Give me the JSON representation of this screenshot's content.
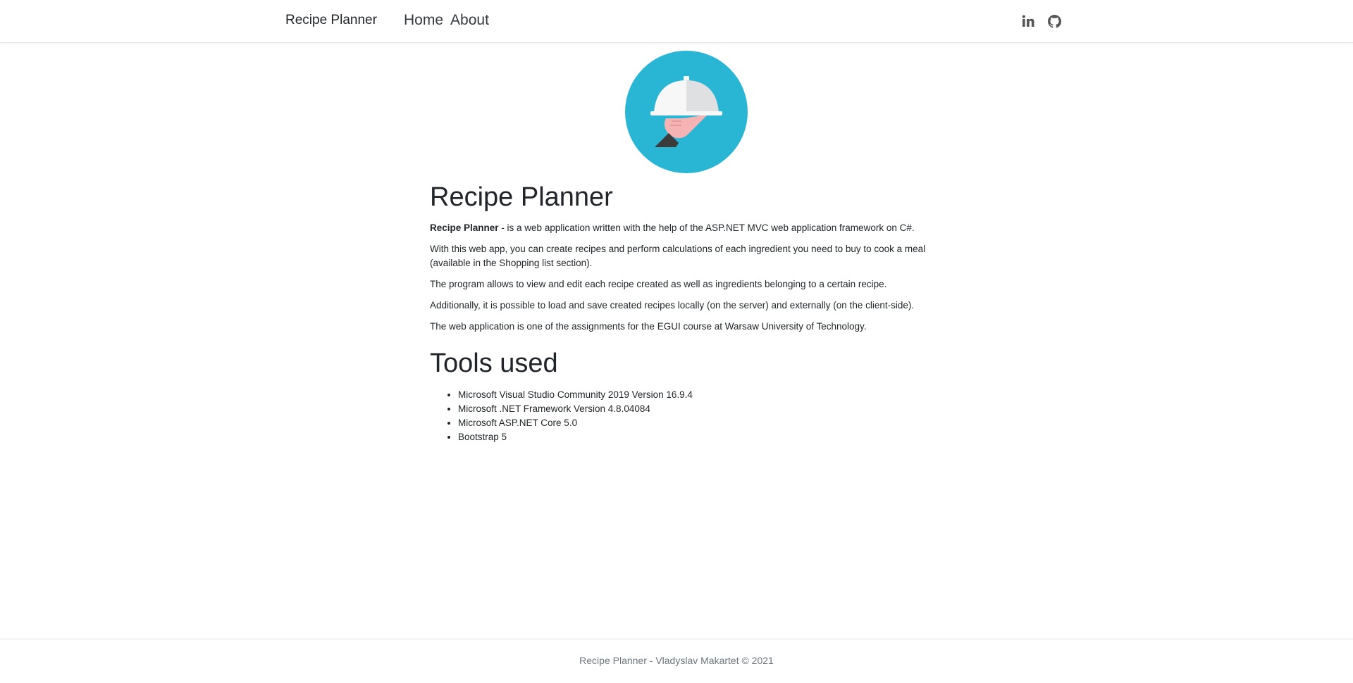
{
  "header": {
    "brand": "Recipe Planner",
    "nav": [
      "Home",
      "About"
    ],
    "social_icons": [
      "linkedin-icon",
      "github-icon"
    ]
  },
  "logo": {
    "icon": "cloche-serving-hand-icon",
    "colors": {
      "circle": "#29b6d5",
      "cloche_light": "#f7f7f7",
      "cloche_dark": "#dfe0e2",
      "hand": "#f5b3b3",
      "cuff": "#3b3b3b"
    }
  },
  "main": {
    "title": "Recipe Planner",
    "intro_bold": "Recipe Planner",
    "intro_rest": " - is a web application written with the help of the ASP.NET MVC web application framework on C#.",
    "paragraphs": [
      "With this web app, you can create recipes and perform calculations of each ingredient you need to buy to cook a meal (available in the Shopping list section).",
      "The program allows to view and edit each recipe created as well as ingredients belonging to a certain recipe.",
      "Additionally, it is possible to load and save created recipes locally (on the server) and externally (on the client-side).",
      "The web application is one of the assignments for the EGUI course at Warsaw University of Technology."
    ],
    "tools_title": "Tools used",
    "tools": [
      "Microsoft Visual Studio Community 2019 Version 16.9.4",
      "Microsoft .NET Framework Version 4.8.04084",
      "Microsoft ASP.NET Core 5.0",
      "Bootstrap 5"
    ]
  },
  "footer": {
    "text": "Recipe Planner - Vladyslav Makartet © 2021"
  }
}
